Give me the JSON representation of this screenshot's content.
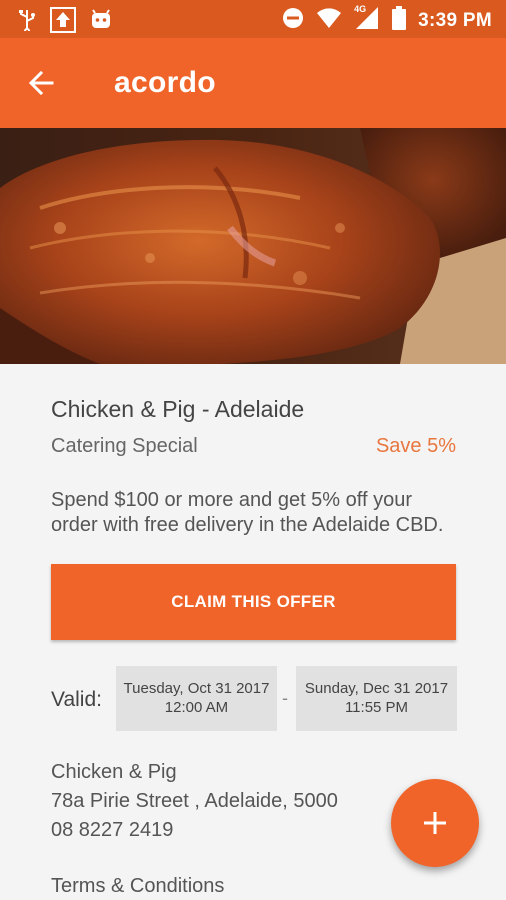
{
  "status_bar": {
    "time": "3:39 PM",
    "network": "4G",
    "icons": [
      "usb-icon",
      "upload-icon",
      "android-icon",
      "do-not-disturb-icon",
      "wifi-icon",
      "cell-signal-icon",
      "battery-icon"
    ]
  },
  "toolbar": {
    "back_icon": "arrow-left-icon",
    "title": "acordo"
  },
  "hero": {
    "description": "roast pork crackling photo"
  },
  "offer": {
    "business_name": "Chicken & Pig - Adelaide",
    "category": "Catering Special",
    "discount": "Save 5%",
    "description": "Spend $100 or more and get 5% off your order with free delivery in the Adelaide CBD.",
    "claim_label": "CLAIM THIS OFFER"
  },
  "validity": {
    "label": "Valid:",
    "start_date": "Tuesday, Oct 31 2017",
    "start_time": "12:00 AM",
    "separator": "-",
    "end_date": "Sunday, Dec 31 2017",
    "end_time": "11:55 PM"
  },
  "contact": {
    "name": "Chicken & Pig",
    "address": "78a Pirie Street , Adelaide, 5000",
    "phone": "08 8227 2419"
  },
  "terms_label": "Terms & Conditions",
  "fab_icon": "plus-icon",
  "colors": {
    "status_bar": "#d9591f",
    "primary": "#f0642a",
    "accent_text": "#e8763e",
    "background": "#f4f4f4",
    "date_box": "#e1e1e1"
  }
}
